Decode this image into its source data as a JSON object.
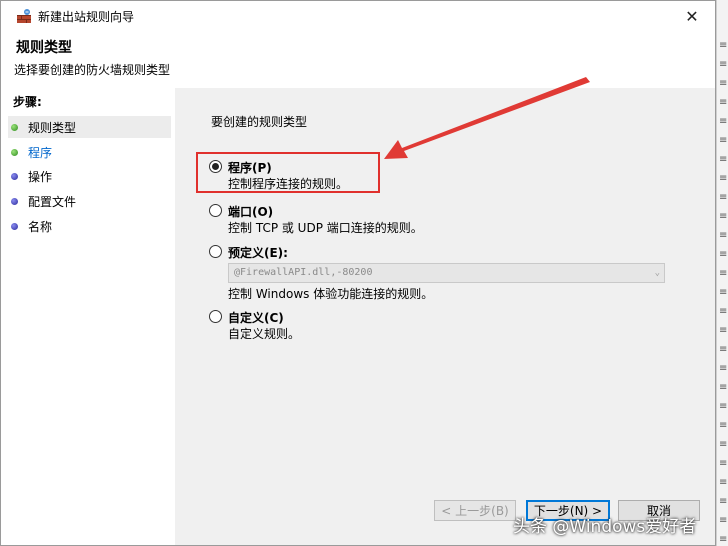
{
  "window": {
    "title": "新建出站规则向导",
    "close_label": "✕"
  },
  "header": {
    "title": "规则类型",
    "subtitle": "选择要创建的防火墙规则类型"
  },
  "sidebar": {
    "steps_label": "步骤:",
    "items": [
      {
        "label": "规则类型",
        "state": "current"
      },
      {
        "label": "程序",
        "state": "link"
      },
      {
        "label": "操作",
        "state": "normal"
      },
      {
        "label": "配置文件",
        "state": "normal"
      },
      {
        "label": "名称",
        "state": "normal"
      }
    ]
  },
  "main": {
    "prompt": "要创建的规则类型",
    "options": [
      {
        "label": "程序(P)",
        "description": "控制程序连接的规则。",
        "checked": true
      },
      {
        "label": "端口(O)",
        "description": "控制 TCP 或 UDP 端口连接的规则。",
        "checked": false
      },
      {
        "label": "预定义(E):",
        "description": "控制 Windows 体验功能连接的规则。",
        "checked": false
      },
      {
        "label": "自定义(C)",
        "description": "自定义规则。",
        "checked": false
      }
    ],
    "predefined_select_value": "@FirewallAPI.dll,-80200"
  },
  "buttons": {
    "back": "< 上一步(B)",
    "next": "下一步(N) >",
    "cancel": "取消"
  },
  "watermark": "头条 @Windows爱好者",
  "colors": {
    "highlight": "#e0302d",
    "link": "#0066cc",
    "content_bg": "#f0f0f0"
  }
}
